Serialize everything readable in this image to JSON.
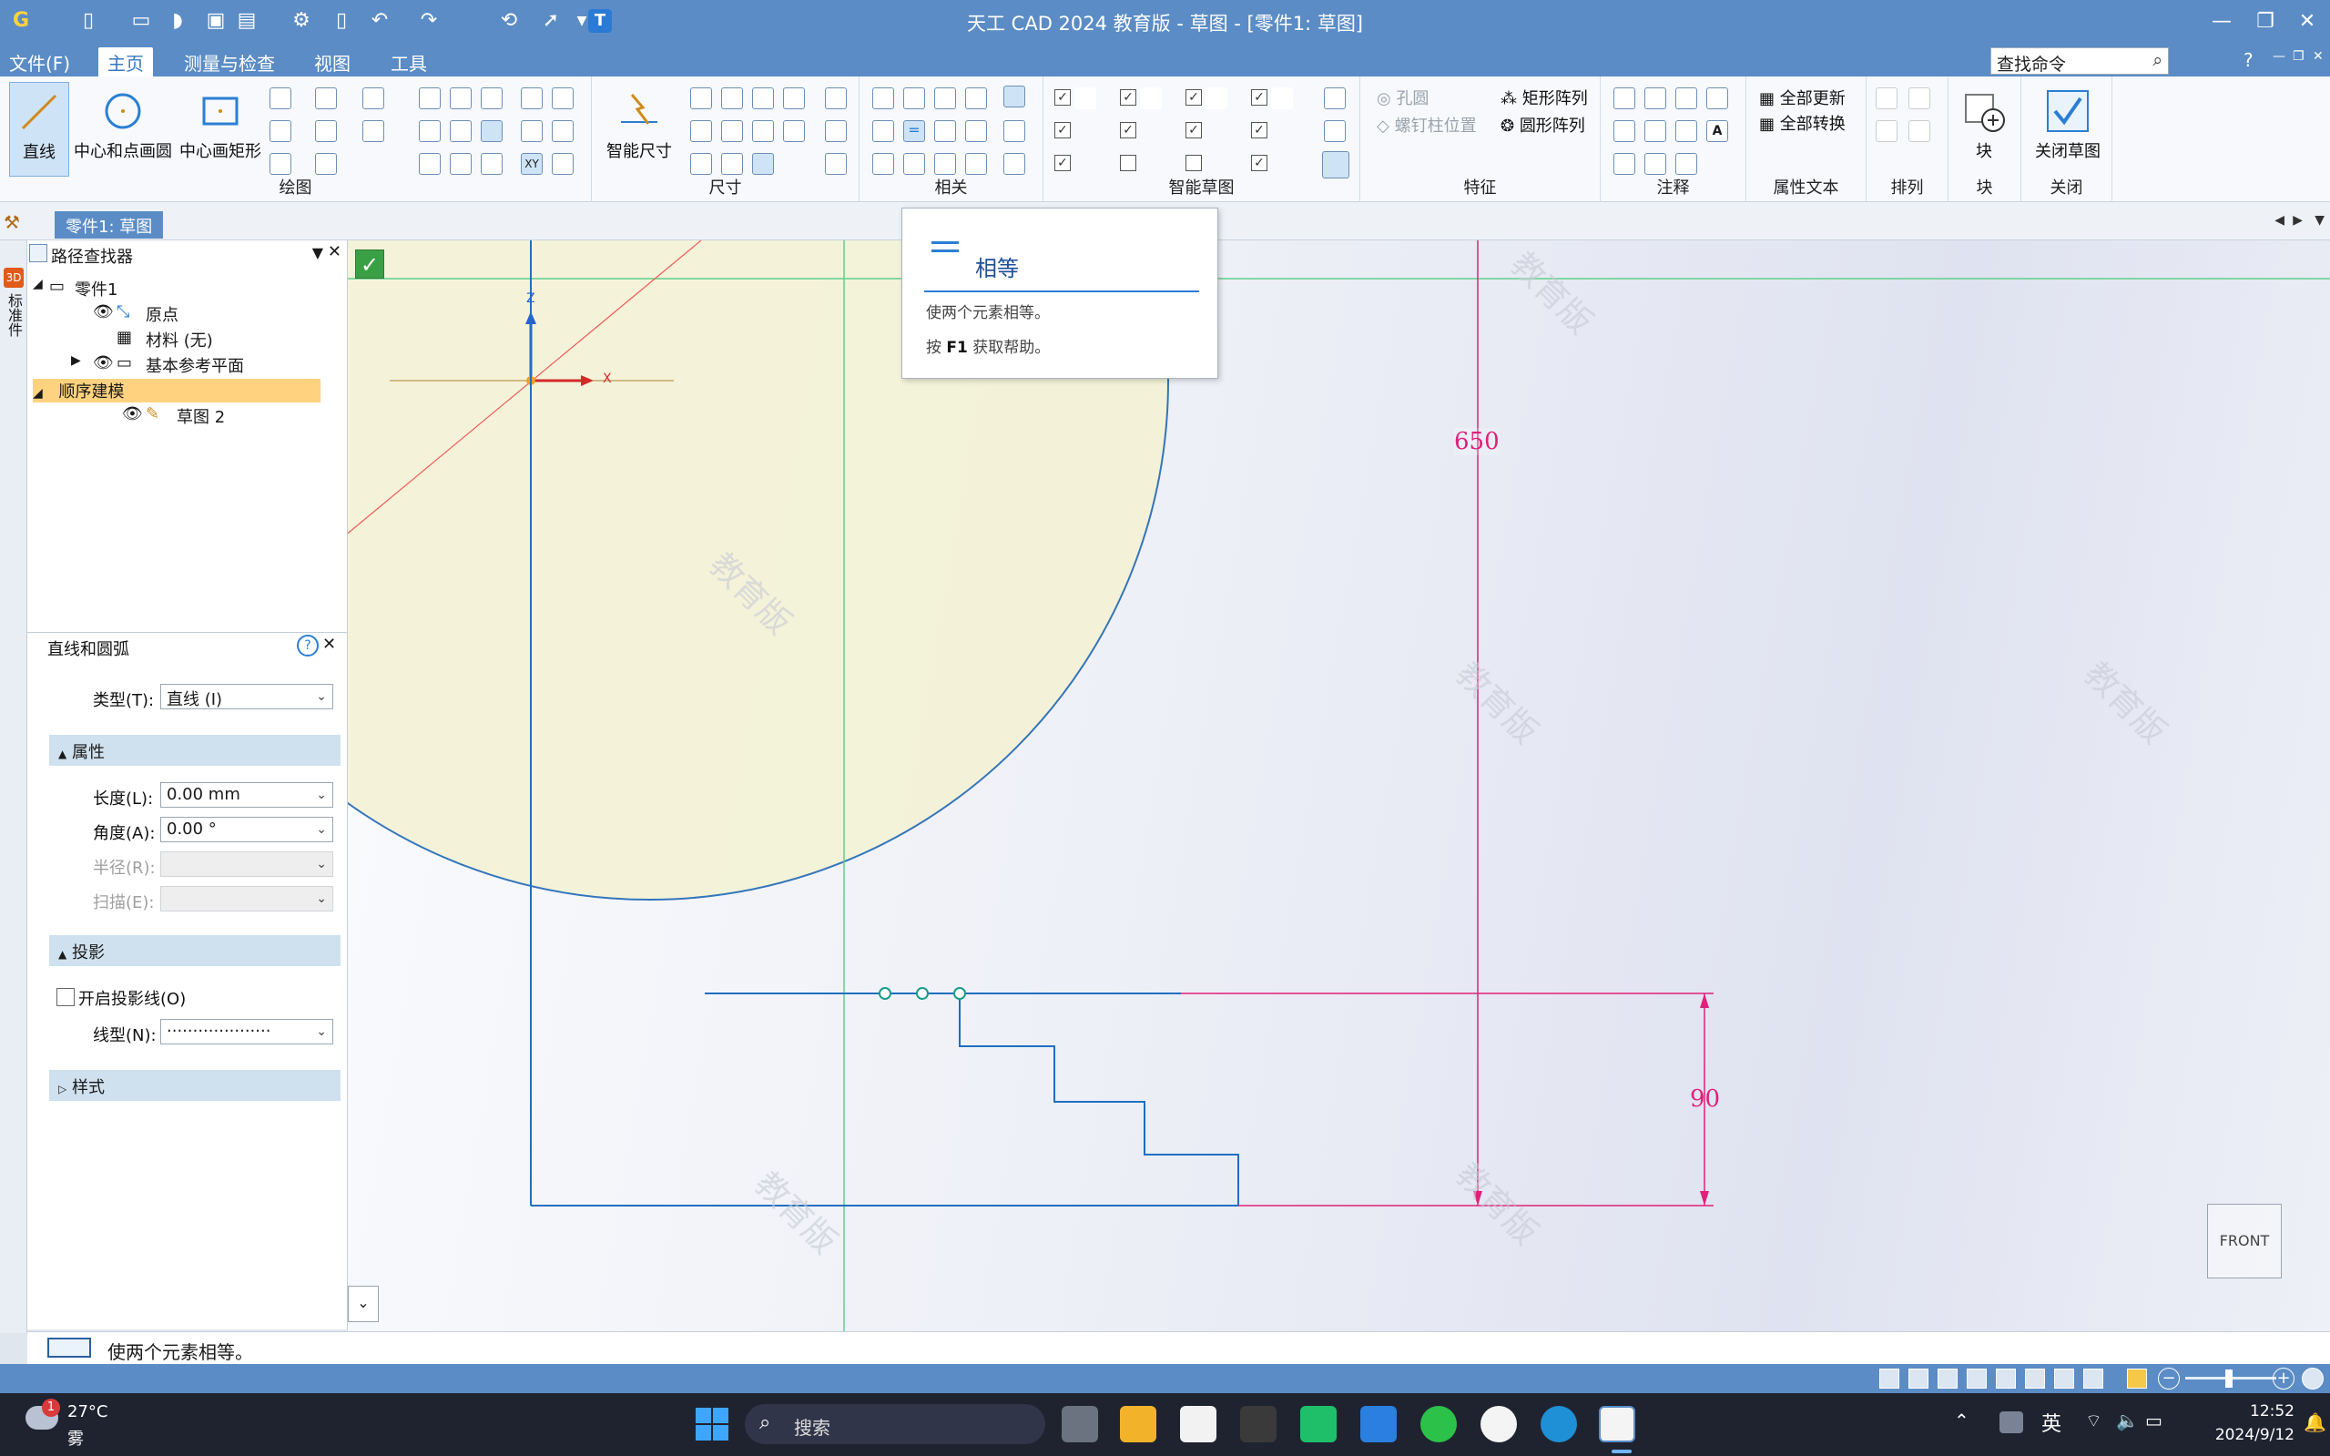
{
  "app": {
    "title": "天工 CAD 2024 教育版 - 草图 - [零件1: 草图]"
  },
  "menu": {
    "items": [
      "文件(F)",
      "主页",
      "测量与检查",
      "视图",
      "工具"
    ],
    "search_value": "查找命令",
    "help": "?"
  },
  "ribbon": {
    "big_line": "直线",
    "big_circle": "中心和点画圆",
    "big_rect": "中心画矩形",
    "smart_dim": "智能尺寸",
    "hole": "孔圆",
    "bolt": "螺钉柱位置",
    "rect_array": "矩形阵列",
    "circ_array": "圆形阵列",
    "update_all": "全部更新",
    "convert_all": "全部转换",
    "block": "块",
    "close_sketch": "关闭草图",
    "groups": {
      "draw": "绘图",
      "dim": "尺寸",
      "rel": "相关",
      "smart": "智能草图",
      "feature": "特征",
      "annot": "注释",
      "attr": "属性文本",
      "arrange": "排列",
      "block": "块",
      "close": "关闭"
    }
  },
  "doc_tab": "零件1: 草图",
  "left_strip": {
    "badge": "3D",
    "label": "标准件"
  },
  "pathfinder": {
    "title": "路径查找器",
    "part": "零件1",
    "origin": "原点",
    "material": "材料 (无)",
    "ref_planes": "基本参考平面",
    "seq_model": "顺序建模",
    "sketch": "草图 2"
  },
  "props": {
    "title": "直线和圆弧",
    "type_label": "类型(T):",
    "type_value": "直线 (I)",
    "section_attr": "属性",
    "length_label": "长度(L):",
    "length_value": "0.00 mm",
    "angle_label": "角度(A):",
    "angle_value": "0.00 °",
    "radius_label": "半径(R):",
    "sweep_label": "扫描(E):",
    "section_proj": "投影",
    "proj_check": "开启投影线(O)",
    "linetype_label": "线型(N):",
    "linetype_value": "····················",
    "section_style": "样式"
  },
  "tooltip": {
    "title": "相等",
    "desc": "使两个元素相等。",
    "hint_pre": "按",
    "hint_key": "F1",
    "hint_post": "获取帮助。"
  },
  "canvas": {
    "dim_650": "650",
    "dim_90": "90",
    "view_cube": "FRONT",
    "axis_z": "Z",
    "axis_x": "X",
    "watermark": "教育版"
  },
  "status": {
    "message": "使两个元素相等。"
  },
  "taskbar": {
    "weather_temp": "27°C",
    "weather_desc": "雾",
    "weather_badge": "1",
    "search": "搜索",
    "lang": "英",
    "time": "12:52",
    "date": "2024/9/12"
  },
  "colors": {
    "accent": "#5b8cc5",
    "sketch_line": "#1f6fc0",
    "dimension": "#e0207a",
    "tooltip_title": "#1f4f9a"
  }
}
